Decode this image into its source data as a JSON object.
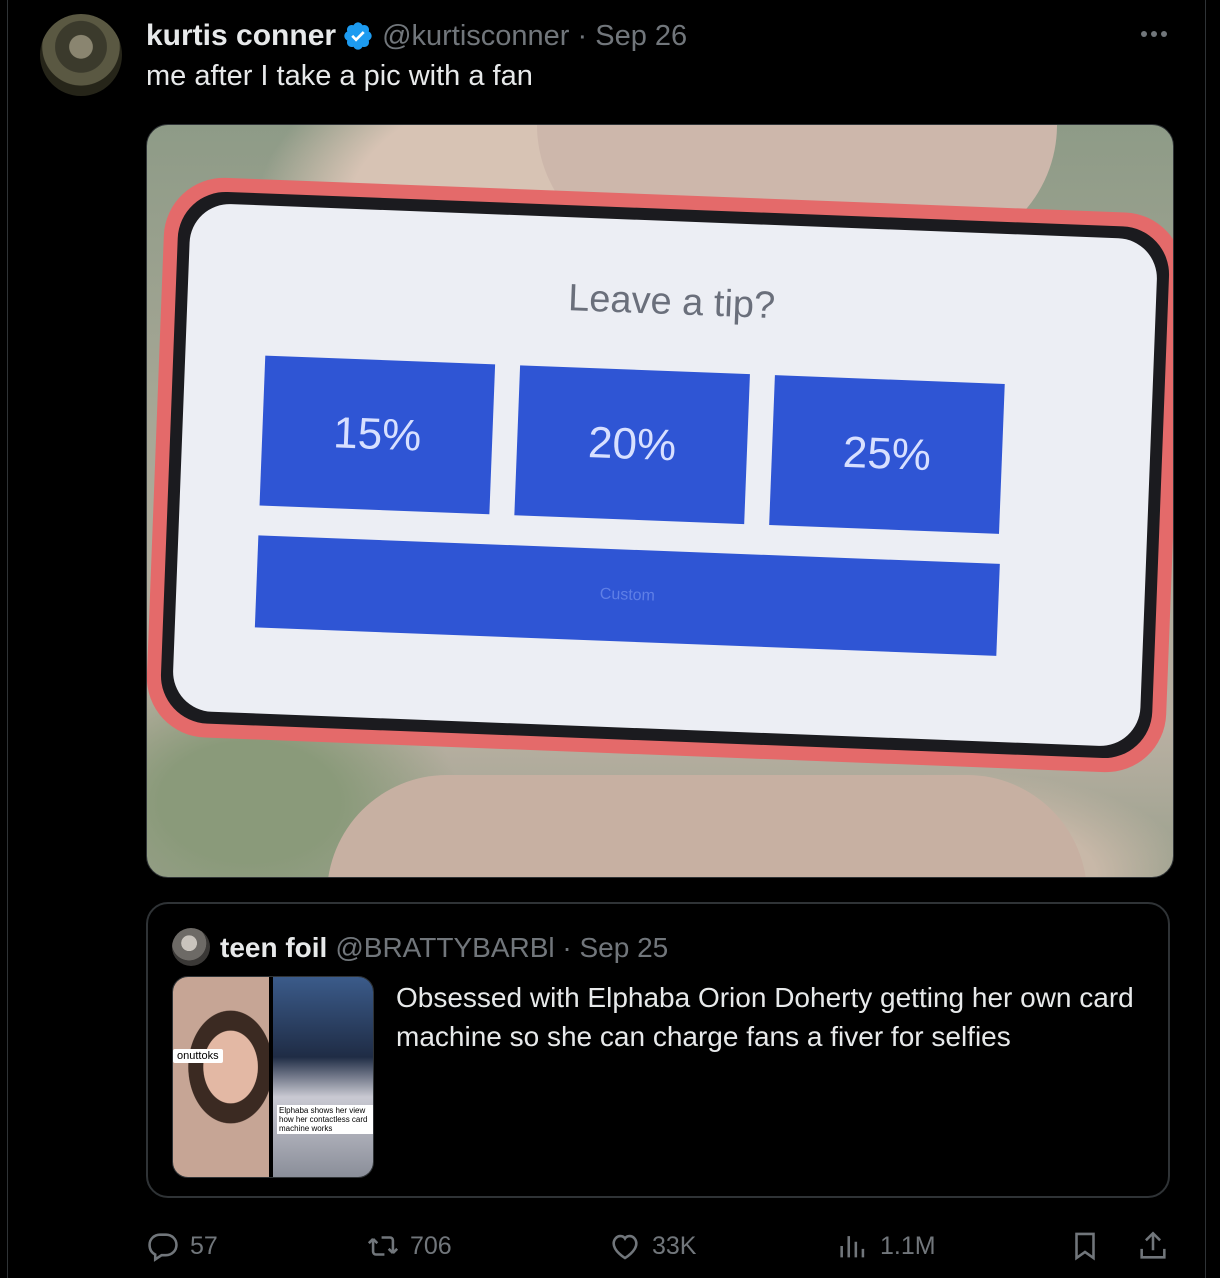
{
  "tweet": {
    "author": {
      "name": "kurtis conner",
      "handle": "@kurtisconner",
      "time": "Sep 26",
      "handle_time": "@kurtisconner · Sep 26"
    },
    "text": "me after I take a pic with a fan",
    "media": {
      "prompt": "Leave a tip?",
      "options": [
        "15%",
        "20%",
        "25%"
      ],
      "custom": "Custom"
    },
    "quote": {
      "name": "teen foil",
      "handle_time": "@BRATTYBARBl · Sep 25",
      "text": "Obsessed with Elphaba Orion Doherty getting her own card machine so she can charge fans a fiver for selfies",
      "thumb_label": "onuttoks",
      "thumb_caption": "Elphaba shows her view how her contactless card machine works"
    },
    "actions": {
      "replies": "57",
      "reposts": "706",
      "likes": "33K",
      "views": "1.1M"
    }
  },
  "colors": {
    "background": "#000000",
    "text": "#e7e9ea",
    "muted": "#71767b",
    "verified": "#1d9bf0",
    "border": "#2f3336"
  }
}
